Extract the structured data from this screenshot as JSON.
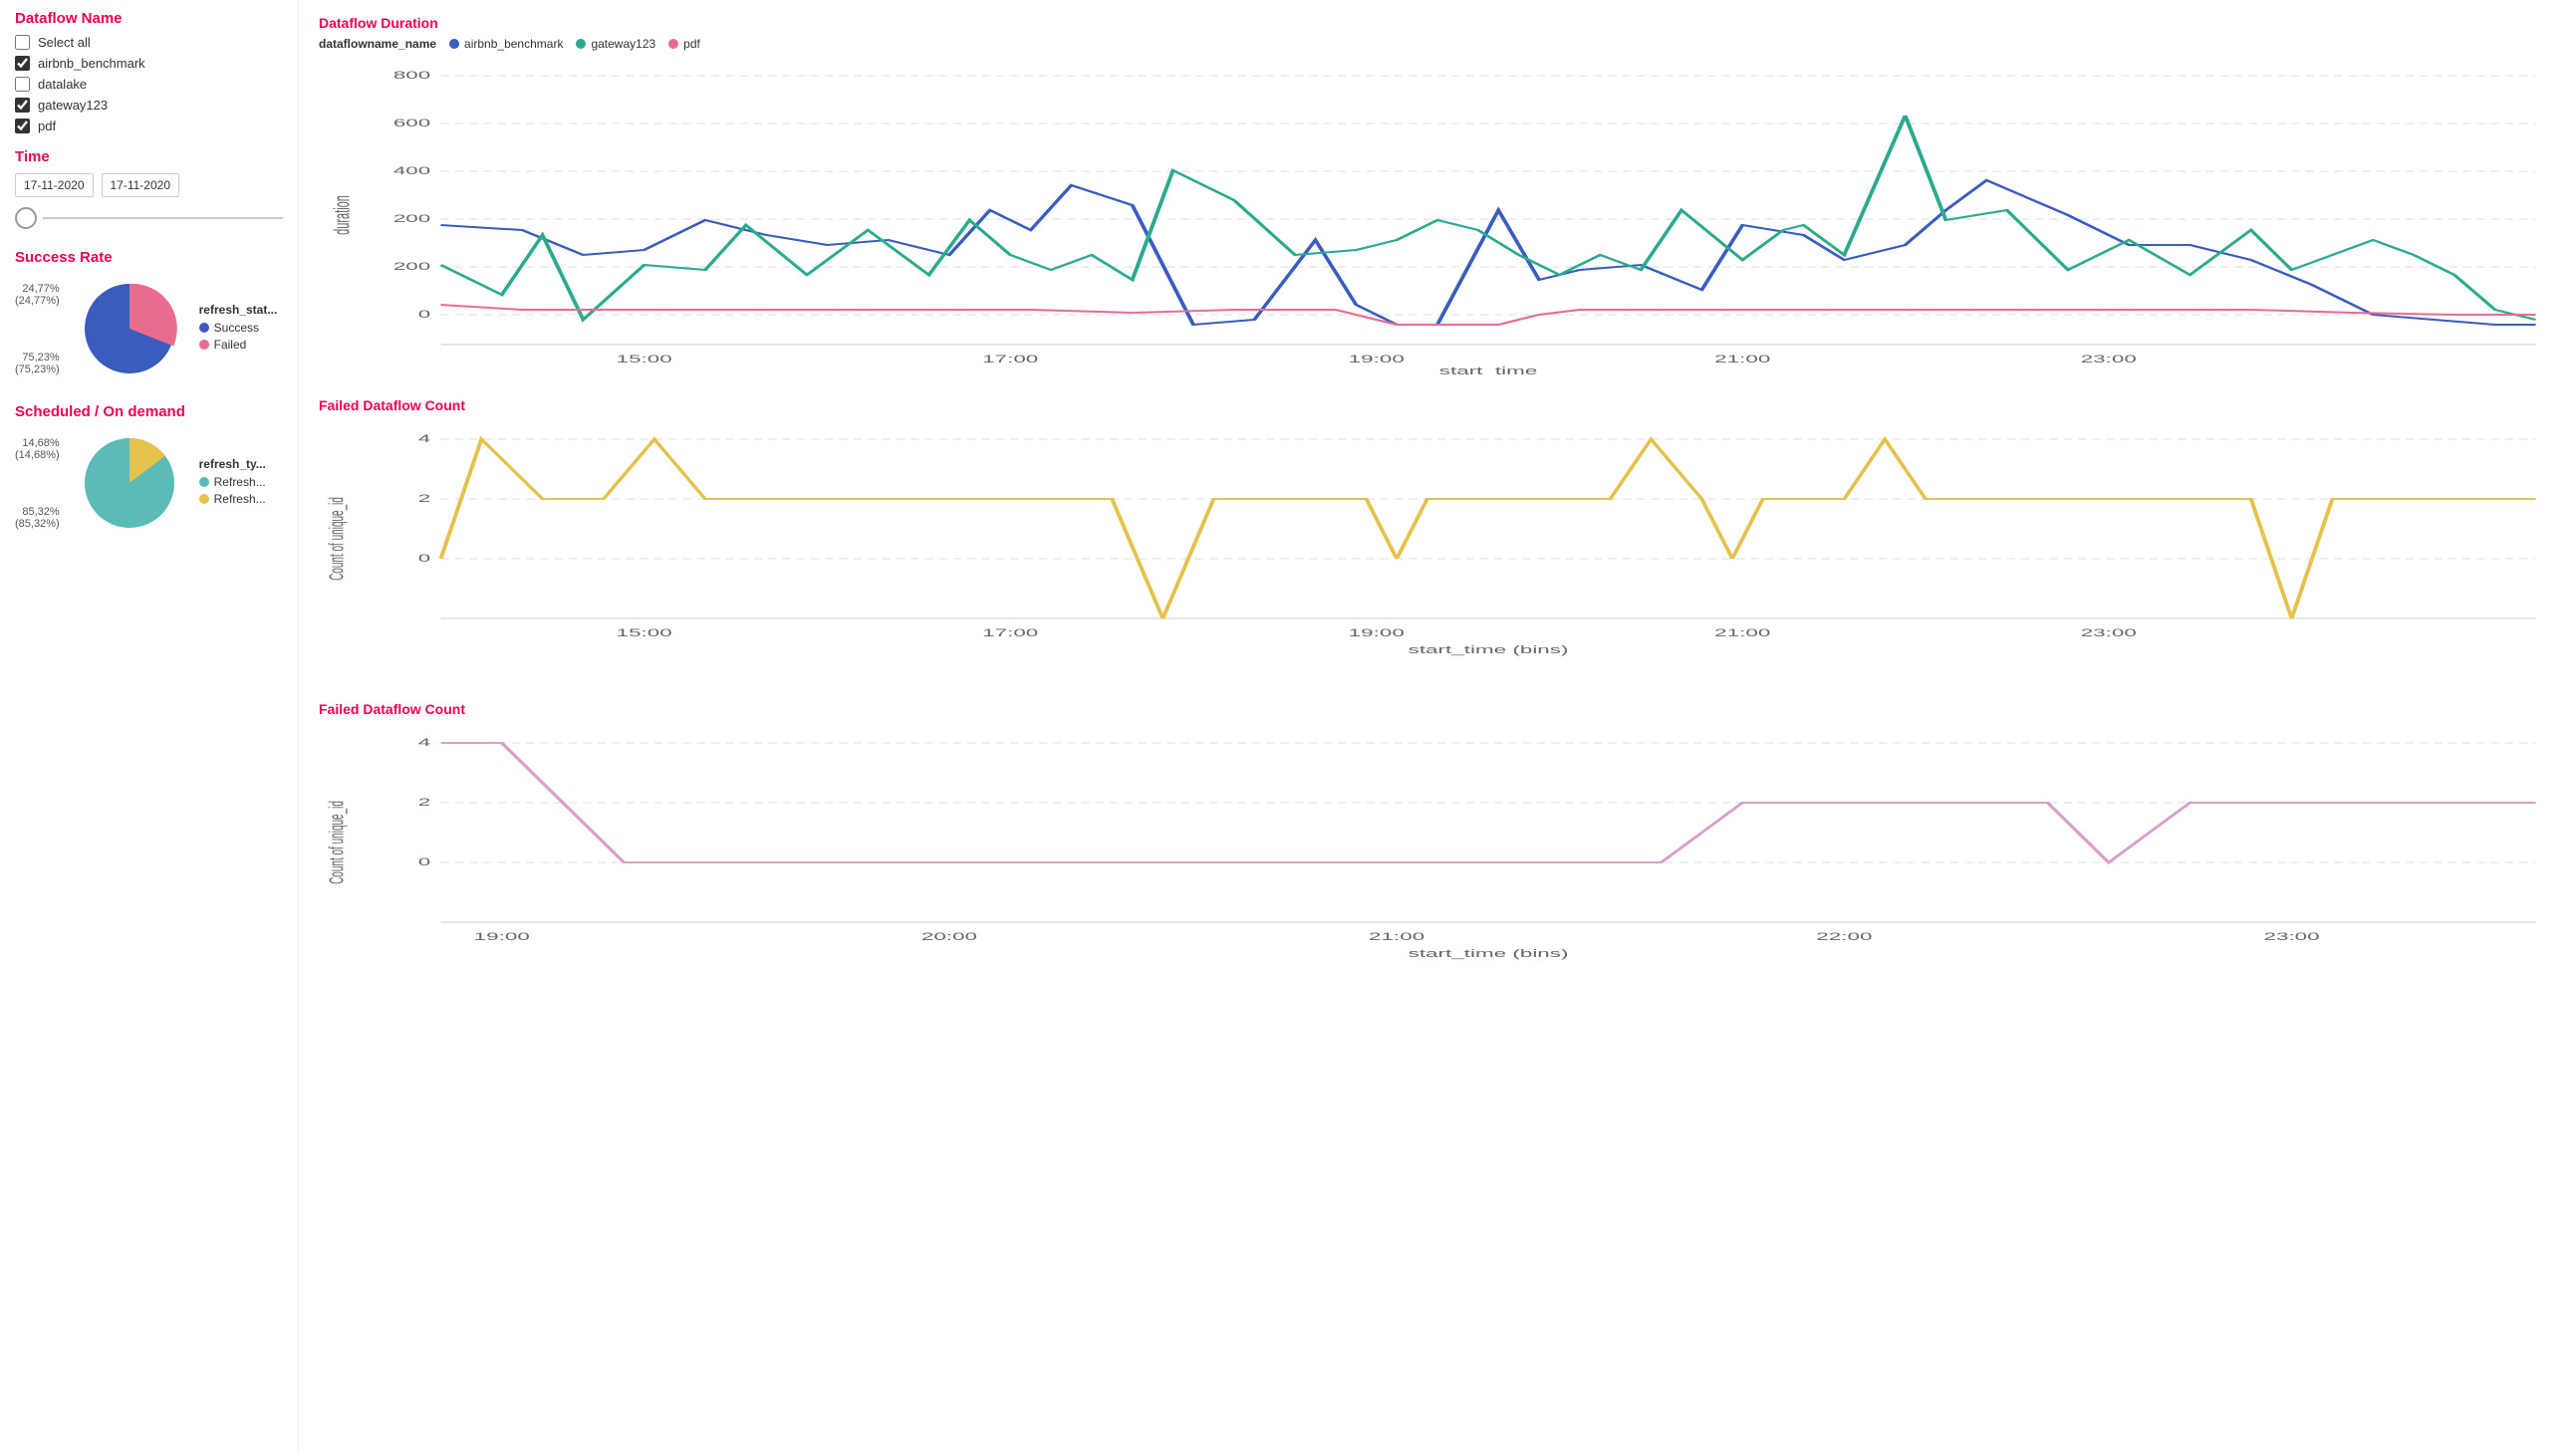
{
  "sidebar": {
    "dataflow_title": "Dataflow Name",
    "select_all_label": "Select all",
    "items": [
      {
        "label": "airbnb_benchmark",
        "checked": true
      },
      {
        "label": "datalake",
        "checked": false
      },
      {
        "label": "gateway123",
        "checked": true
      },
      {
        "label": "pdf",
        "checked": true
      }
    ],
    "time_title": "Time",
    "date_start": "17-11-2020",
    "date_end": "17-11-2020",
    "success_title": "Success Rate",
    "success_legend_title": "refresh_stat...",
    "success_legend": [
      {
        "label": "Success",
        "color": "#3a5cbf"
      },
      {
        "label": "Failed",
        "color": "#e86c8d"
      }
    ],
    "success_labels": [
      {
        "value": "24,77%",
        "sub": "(24,77%)"
      },
      {
        "value": "75,23%",
        "sub": "(75,23%)"
      }
    ],
    "scheduled_title": "Scheduled / On demand",
    "scheduled_legend_title": "refresh_ty...",
    "scheduled_legend": [
      {
        "label": "Refresh...",
        "color": "#5bbcb5"
      },
      {
        "label": "Refresh...",
        "color": "#e5c24c"
      }
    ],
    "scheduled_labels": [
      {
        "value": "14,68%",
        "sub": "(14,68%)"
      },
      {
        "value": "85,32%",
        "sub": "(85,32%)"
      }
    ]
  },
  "charts": {
    "duration_title": "Dataflow Duration",
    "duration_legend_label": "dataflowname_name",
    "duration_legend": [
      {
        "label": "airbnb_benchmark",
        "color": "#3a5cbf"
      },
      {
        "label": "gateway123",
        "color": "#2baa8e"
      },
      {
        "label": "pdf",
        "color": "#e86c8d"
      }
    ],
    "duration_yaxis": "duration",
    "duration_xaxis": "start_time",
    "failed_count_title": "Failed Dataflow Count",
    "failed_count_yaxis": "Count of unique_id",
    "failed_count_xaxis": "start_time (bins)",
    "failed_count2_title": "Failed Dataflow Count",
    "failed_count2_yaxis": "Count of unique_id",
    "failed_count2_xaxis": "start_time (bins)"
  }
}
